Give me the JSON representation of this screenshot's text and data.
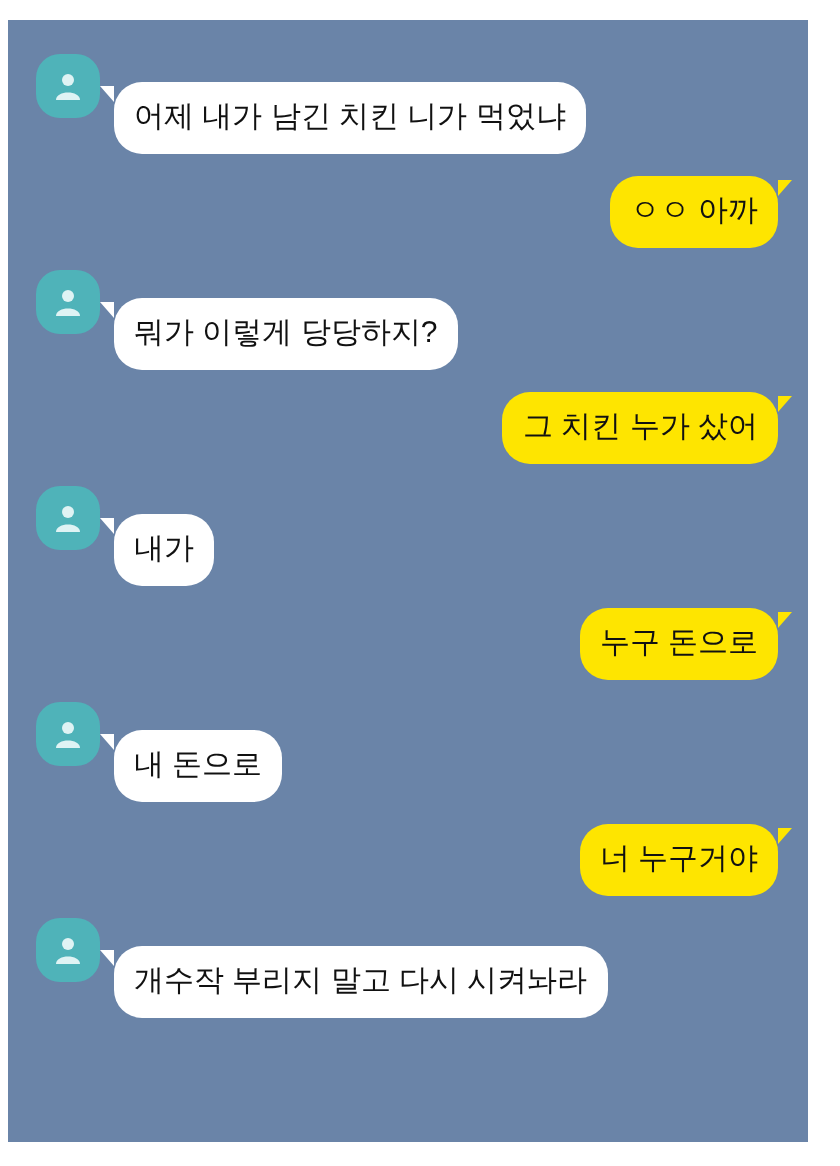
{
  "messages": [
    {
      "kind": "incoming",
      "text": "어제 내가 남긴 치킨 니가 먹었냐"
    },
    {
      "kind": "outgoing",
      "text": "ㅇㅇ 아까"
    },
    {
      "kind": "incoming",
      "text": "뭐가 이렇게 당당하지?"
    },
    {
      "kind": "outgoing",
      "text": "그 치킨 누가 샀어"
    },
    {
      "kind": "incoming",
      "text": "내가"
    },
    {
      "kind": "outgoing",
      "text": "누구 돈으로"
    },
    {
      "kind": "incoming",
      "text": "내 돈으로"
    },
    {
      "kind": "outgoing",
      "text": "너 누구거야"
    },
    {
      "kind": "incoming",
      "text": "개수작 부리지 말고 다시 시켜놔라"
    }
  ]
}
